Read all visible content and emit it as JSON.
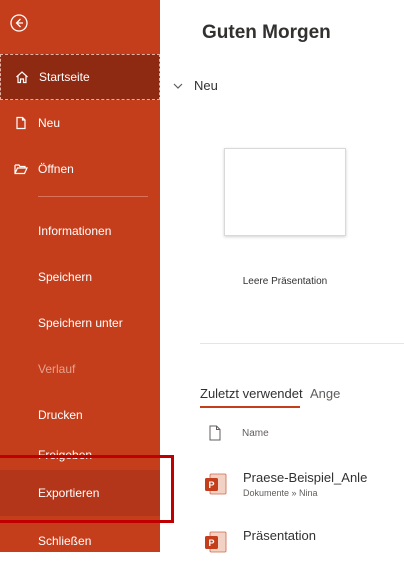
{
  "sidebar": {
    "items": [
      {
        "label": "Startseite",
        "icon": "home-icon"
      },
      {
        "label": "Neu",
        "icon": "new-document-icon"
      },
      {
        "label": "Öffnen",
        "icon": "folder-open-icon"
      },
      {
        "label": "Informationen"
      },
      {
        "label": "Speichern"
      },
      {
        "label": "Speichern unter"
      },
      {
        "label": "Verlauf"
      },
      {
        "label": "Drucken"
      },
      {
        "label": "Freigeben"
      },
      {
        "label": "Exportieren"
      },
      {
        "label": "Schließen"
      }
    ]
  },
  "main": {
    "greeting": "Guten Morgen",
    "new_section": "Neu",
    "template_label": "Leere Präsentation",
    "tabs": [
      "Zuletzt verwendet",
      "Ange"
    ],
    "list_header": "Name",
    "files": [
      {
        "name": "Praese-Beispiel_Anle",
        "path": "Dokumente » Nina"
      },
      {
        "name": "Präsentation",
        "path": ""
      }
    ]
  },
  "colors": {
    "accent": "#c43e1c",
    "active": "#8f2a12",
    "highlight": "#c00000"
  }
}
